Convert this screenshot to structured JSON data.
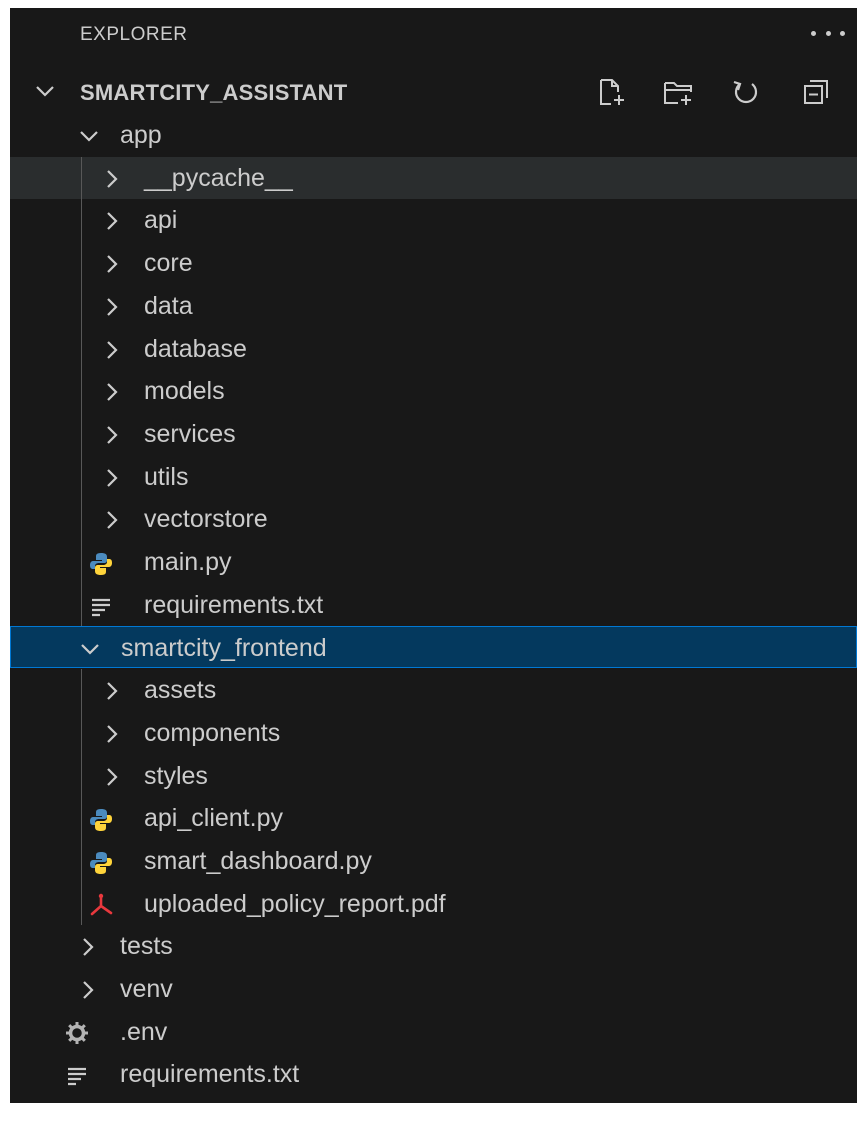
{
  "explorer": {
    "title": "EXPLORER",
    "more_actions_icon": "ellipsis-icon"
  },
  "workspace": {
    "name": "SMARTCITY_ASSISTANT",
    "actions": [
      {
        "name": "new-file-button",
        "icon": "new-file-icon"
      },
      {
        "name": "new-folder-button",
        "icon": "new-folder-icon"
      },
      {
        "name": "refresh-explorer-button",
        "icon": "refresh-icon"
      },
      {
        "name": "collapse-folders-button",
        "icon": "collapse-all-icon"
      }
    ]
  },
  "tree": [
    {
      "label": "app",
      "type": "folder",
      "expanded": true,
      "depth": 1
    },
    {
      "label": "__pycache__",
      "type": "folder",
      "expanded": false,
      "depth": 2,
      "hovered": true
    },
    {
      "label": "api",
      "type": "folder",
      "expanded": false,
      "depth": 2
    },
    {
      "label": "core",
      "type": "folder",
      "expanded": false,
      "depth": 2
    },
    {
      "label": "data",
      "type": "folder",
      "expanded": false,
      "depth": 2
    },
    {
      "label": "database",
      "type": "folder",
      "expanded": false,
      "depth": 2
    },
    {
      "label": "models",
      "type": "folder",
      "expanded": false,
      "depth": 2
    },
    {
      "label": "services",
      "type": "folder",
      "expanded": false,
      "depth": 2
    },
    {
      "label": "utils",
      "type": "folder",
      "expanded": false,
      "depth": 2
    },
    {
      "label": "vectorstore",
      "type": "folder",
      "expanded": false,
      "depth": 2
    },
    {
      "label": "main.py",
      "type": "file",
      "icon": "python-icon",
      "depth": 2
    },
    {
      "label": "requirements.txt",
      "type": "file",
      "icon": "text-file-icon",
      "depth": 2
    },
    {
      "label": "smartcity_frontend",
      "type": "folder",
      "expanded": true,
      "depth": 1,
      "selected": true
    },
    {
      "label": "assets",
      "type": "folder",
      "expanded": false,
      "depth": 2
    },
    {
      "label": "components",
      "type": "folder",
      "expanded": false,
      "depth": 2
    },
    {
      "label": "styles",
      "type": "folder",
      "expanded": false,
      "depth": 2
    },
    {
      "label": "api_client.py",
      "type": "file",
      "icon": "python-icon",
      "depth": 2
    },
    {
      "label": "smart_dashboard.py",
      "type": "file",
      "icon": "python-icon",
      "depth": 2
    },
    {
      "label": "uploaded_policy_report.pdf",
      "type": "file",
      "icon": "pdf-icon",
      "depth": 2
    },
    {
      "label": "tests",
      "type": "folder",
      "expanded": false,
      "depth": 1
    },
    {
      "label": "venv",
      "type": "folder",
      "expanded": false,
      "depth": 1
    },
    {
      "label": ".env",
      "type": "file",
      "icon": "gear-icon",
      "depth": 1
    },
    {
      "label": "requirements.txt",
      "type": "file",
      "icon": "text-file-icon",
      "depth": 1
    }
  ],
  "colors": {
    "background": "#181818",
    "text": "#cccccc",
    "selection_bg": "#04395e",
    "selection_border": "#0078d4",
    "hover_bg": "#2a2d2e",
    "python_blue": "#4b8bbe",
    "python_yellow": "#ffd43b",
    "pdf_red": "#e8383d"
  }
}
